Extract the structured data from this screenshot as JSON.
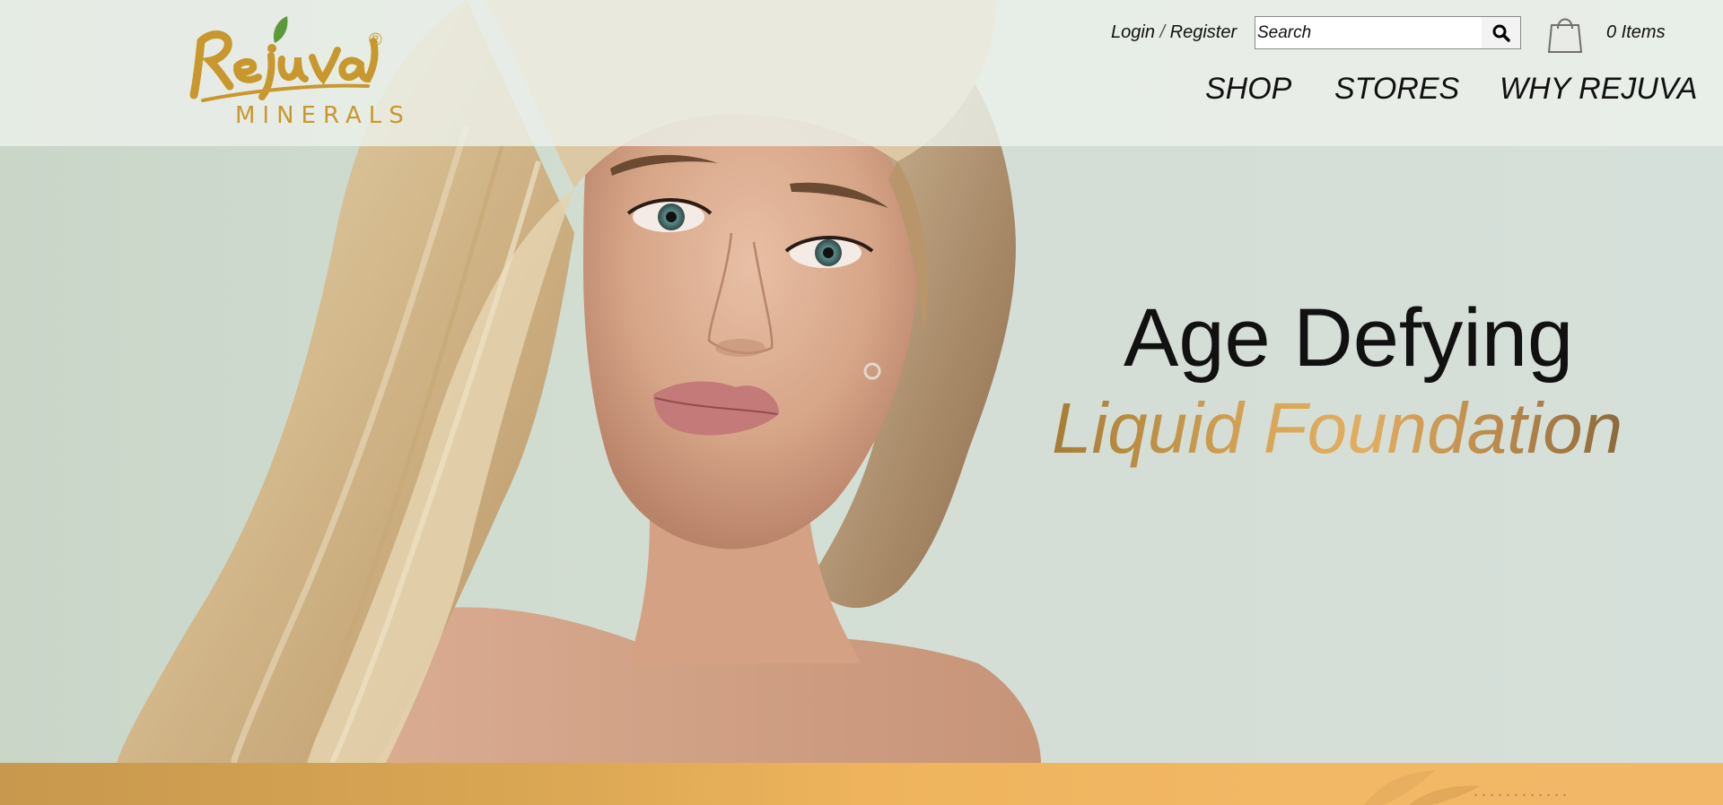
{
  "brand": {
    "name": "Rejuva",
    "sub": "MINERALS",
    "reg": "®",
    "color": "#c8982e",
    "leaf_color": "#5a9a3a"
  },
  "header": {
    "login": "Login",
    "separator": "/",
    "register": "Register",
    "search_placeholder": "Search",
    "search_icon": "search-icon",
    "cart_icon": "shopping-bag-icon",
    "cart_count": "0 Items"
  },
  "nav": [
    {
      "label": "SHOP"
    },
    {
      "label": "STORES"
    },
    {
      "label": "WHY REJUVA"
    }
  ],
  "hero": {
    "headline_1": "Age Defying",
    "headline_2": "Liquid Foundation"
  },
  "colors": {
    "header_bg": "#ecf0ea",
    "hero_bg": "#d2ddd2",
    "band": "#eeb35c",
    "headline_gold": "#d9a658"
  }
}
